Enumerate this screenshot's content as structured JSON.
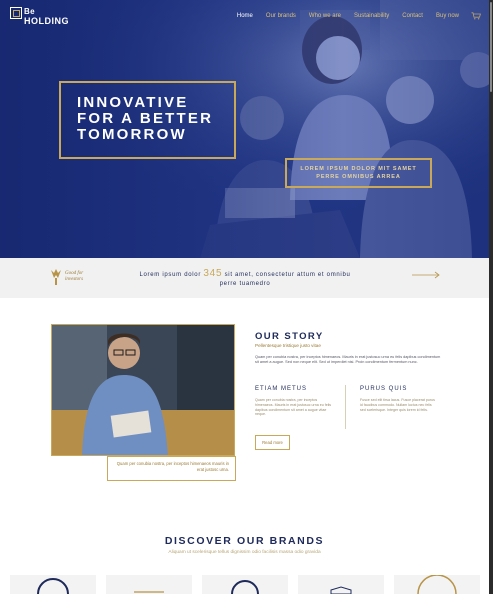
{
  "brand": {
    "line1": "Be",
    "line2": "HOLDING"
  },
  "nav": {
    "items": [
      {
        "label": "Home",
        "active": true
      },
      {
        "label": "Our brands",
        "active": false
      },
      {
        "label": "Who we are",
        "active": false
      },
      {
        "label": "Sustainability",
        "active": false
      },
      {
        "label": "Contact",
        "active": false
      },
      {
        "label": "Buy now",
        "active": false
      }
    ],
    "cart_icon": "cart-icon"
  },
  "hero": {
    "headline": "INNOVATIVE\nFOR A BETTER\nTOMORROW",
    "tagline": "LOREM IPSUM DOLOR MIT SAMET PERRE OMNIBUS ARREA"
  },
  "band": {
    "badge": "Good for investors",
    "text_before": "Lorem ipsum dolor ",
    "number": "345",
    "text_after": " sit amet, consectetur attum et omnibu perre tuamedro",
    "arrow_icon": "long-arrow-right-icon"
  },
  "story": {
    "title": "OUR STORY",
    "subtitle": "Pellentesque tristique justo vitae",
    "body": "Quam per conubia nostra, per inceptos himenaeos. Mauris in erat justosuc urna eu felis dapibus condimentum sit amet a augue. Sed non neque elit. Sed ut imperdiet nisi. Proin condimentum fermentum nunc.",
    "col1_title": "ETIAM METUS",
    "col1_body": "Quam per conubia nostra, per inceptos himenaeos. Mauris in erat justosuc urna eu felis dapibus condimentum sit amet a augue vitae neque.",
    "col2_title": "PURUS QUIS",
    "col2_body": "Fusce sed elit tirsa lacus. Fusce placerat purus id faucibus commodo. Nullam luctus nec felis sed scelerisque. Integer quis lorem id felis.",
    "read_more": "Read more",
    "caption": "Quam per conubia nostra, per inceptos himenaeos mauris in erat justosc urna."
  },
  "brands": {
    "title": "DISCOVER OUR BRANDS",
    "subtitle": "Aliquam ut scelerisque tellus dignissim odio facilisis massa odio gravida"
  },
  "colors": {
    "navy": "#1e2a5a",
    "gold": "#c9a85a",
    "hero_blue": "#233a86"
  }
}
